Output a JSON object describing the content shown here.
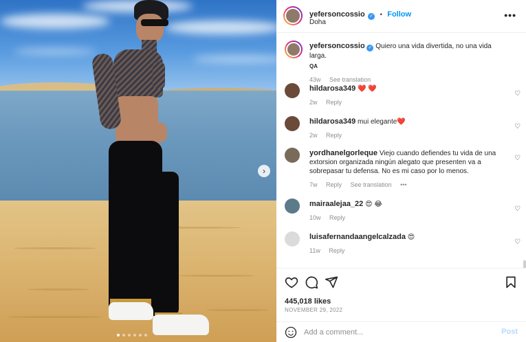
{
  "post": {
    "author": "yefersoncossio",
    "verified_mark": "✓",
    "follow_separator": "•",
    "follow_label": "Follow",
    "location": "Doha",
    "more_icon": "more-horizontal-icon"
  },
  "caption": {
    "username": "yefersoncossio",
    "text": "Quiero una vida divertida, no una vida larga.",
    "sub": "QA",
    "time": "43w",
    "translate_label": "See translation"
  },
  "comments": [
    {
      "username": "hildarosa349",
      "text": "❤️ ❤️",
      "time": "2w",
      "reply": "Reply"
    },
    {
      "username": "hildarosa349",
      "text": "mui elegante❤️",
      "time": "2w",
      "reply": "Reply"
    },
    {
      "username": "yordhanelgorleque",
      "text": "Viejo cuando defiendes tu vida de una extorsion organizada ningún alegato que presenten va a sobrepasar tu defensa. No es mi caso por lo menos.",
      "time": "7w",
      "reply": "Reply",
      "translate": "See translation",
      "more": "•••"
    },
    {
      "username": "mairaalejaa_22",
      "text": "😍 😂",
      "time": "10w",
      "reply": "Reply"
    },
    {
      "username": "luisafernandaangelcalzada",
      "text": "😍",
      "time": "11w",
      "reply": "Reply"
    }
  ],
  "actions": {
    "like_icon": "heart-icon",
    "comment_icon": "comment-icon",
    "share_icon": "send-icon",
    "save_icon": "bookmark-icon"
  },
  "likes": "445,018 likes",
  "date": "NOVEMBER 29, 2022",
  "add_comment": {
    "placeholder": "Add a comment...",
    "post_label": "Post"
  },
  "carousel": {
    "next_icon": "chevron-right-icon",
    "total_dots": 6,
    "active_dot": 1
  },
  "colors": {
    "link_blue": "#0095f6",
    "verified_blue": "#3897f0",
    "heart_red": "#ed4956",
    "muted": "#8e8e8e"
  }
}
